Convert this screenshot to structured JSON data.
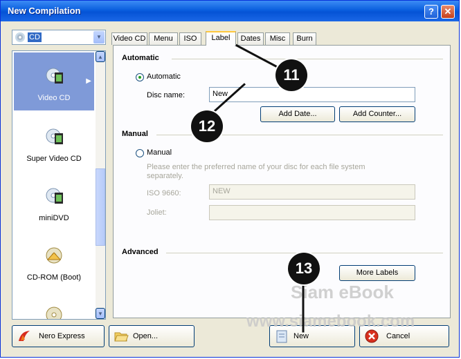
{
  "window": {
    "title": "New Compilation",
    "help_glyph": "?",
    "close_glyph": "✕"
  },
  "disc_type": {
    "selected": "CD"
  },
  "categories": [
    {
      "label": "Video CD",
      "active": true
    },
    {
      "label": "Super Video CD",
      "active": false
    },
    {
      "label": "miniDVD",
      "active": false
    },
    {
      "label": "CD-ROM (Boot)",
      "active": false
    }
  ],
  "tabs": [
    "Video CD",
    "Menu",
    "ISO",
    "Label",
    "Dates",
    "Misc",
    "Burn"
  ],
  "active_tab": "Label",
  "automatic": {
    "section_title": "Automatic",
    "radio_label": "Automatic",
    "disc_name_label": "Disc name:",
    "disc_name_value": "New",
    "add_date_label": "Add Date...",
    "add_counter_label": "Add Counter..."
  },
  "manual": {
    "section_title": "Manual",
    "radio_label": "Manual",
    "hint": "Please enter the preferred name of your disc for each file system separately.",
    "iso_label": "ISO 9660:",
    "iso_value": "NEW",
    "joliet_label": "Joliet:",
    "joliet_value": ""
  },
  "advanced": {
    "section_title": "Advanced",
    "more_labels": "More Labels"
  },
  "footer": {
    "nero_express": "Nero Express",
    "open": "Open...",
    "new": "New",
    "cancel": "Cancel"
  },
  "callouts": [
    "11",
    "12",
    "13"
  ],
  "watermark": {
    "line1": "Siam eBook",
    "line2": "www.siamebook.com"
  }
}
